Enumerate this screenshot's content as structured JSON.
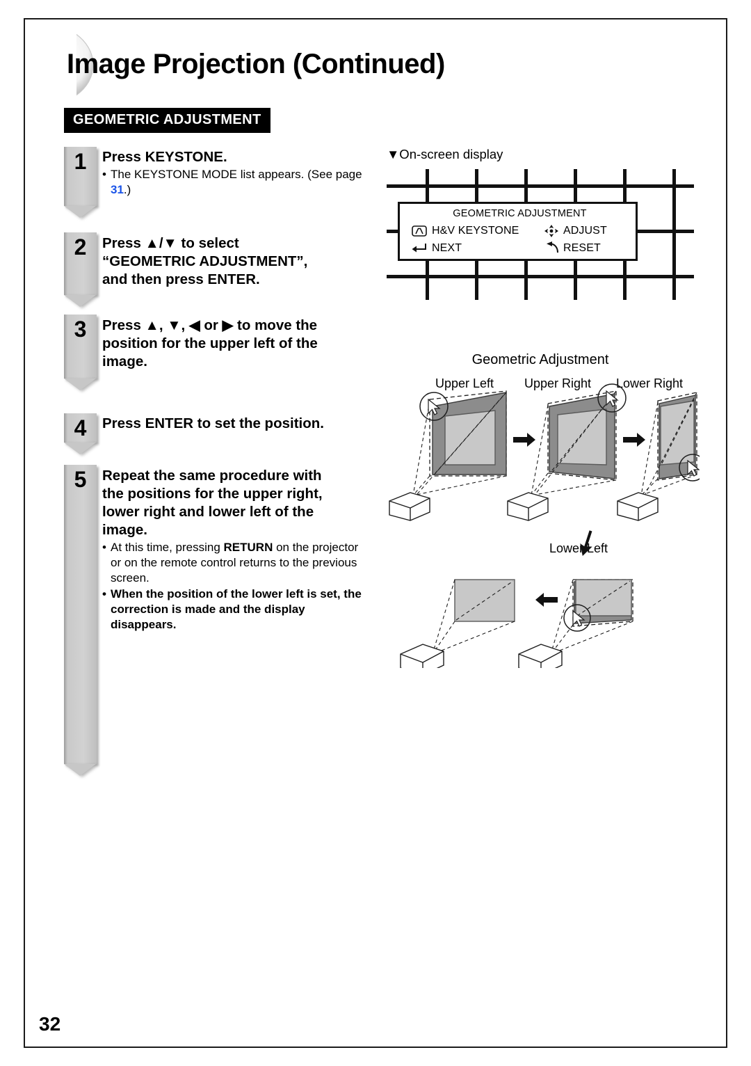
{
  "document": {
    "title": "Image Projection (Continued)",
    "section_label": "GEOMETRIC ADJUSTMENT",
    "page_number": "32"
  },
  "steps": [
    {
      "number": "1",
      "heading_plain": "Press ",
      "heading_bold": "KEYSTONE",
      "heading_tail": ".",
      "bullets": [
        {
          "text_before": "The KEYSTONE MODE list appears. (See page ",
          "link": "31",
          "text_after": ".)",
          "bold": false
        }
      ]
    },
    {
      "number": "2",
      "heading_line1": "Press ▲/▼ to select",
      "heading_line2": "“GEOMETRIC ADJUSTMENT”,",
      "heading_line3_plain": "and then press ",
      "heading_line3_bold": "ENTER",
      "heading_line3_tail": ".",
      "bullets": []
    },
    {
      "number": "3",
      "heading_line1": "Press ▲, ▼, ◀ or ▶ to move the",
      "heading_line2": "position for the upper left of the",
      "heading_line3": "image.",
      "bullets": []
    },
    {
      "number": "4",
      "heading_plain": "Press ",
      "heading_bold": "ENTER",
      "heading_tail": " to set the position.",
      "bullets": []
    },
    {
      "number": "5",
      "heading_line1": "Repeat the same procedure with",
      "heading_line2": "the positions for the upper right,",
      "heading_line3": "lower right and lower left of the",
      "heading_line4": "image.",
      "bullets": [
        {
          "text_before": "At this time, pressing ",
          "kb": "RETURN",
          "text_after": " on the projector or on the remote control returns to the previous screen.",
          "bold": false
        },
        {
          "text_before": "When the position of the lower left is set, the correction is made and the display disappears.",
          "bold": true
        }
      ]
    }
  ],
  "osd": {
    "caption": "▼On-screen display",
    "title": "GEOMETRIC ADJUSTMENT",
    "rows": [
      {
        "icon": "keystone-icon",
        "label": "H&V KEYSTONE"
      },
      {
        "icon": "adjust-diamond-icon",
        "label": "ADJUST"
      },
      {
        "icon": "enter-arrow-icon",
        "label": "NEXT"
      },
      {
        "icon": "reset-curved-arrow-icon",
        "label": "RESET"
      }
    ]
  },
  "diagram": {
    "title": "Geometric Adjustment",
    "labels": {
      "upper_left": "Upper Left",
      "upper_right": "Upper Right",
      "lower_right": "Lower Right",
      "lower_left": "Lower Left"
    }
  },
  "colors": {
    "link": "#1b54e8",
    "screen_outer_gray": "#8c8c8c",
    "screen_inner_gray": "#c8c8c8",
    "step_marker_gray": "#cfcfcf",
    "band_background": "#000000"
  }
}
